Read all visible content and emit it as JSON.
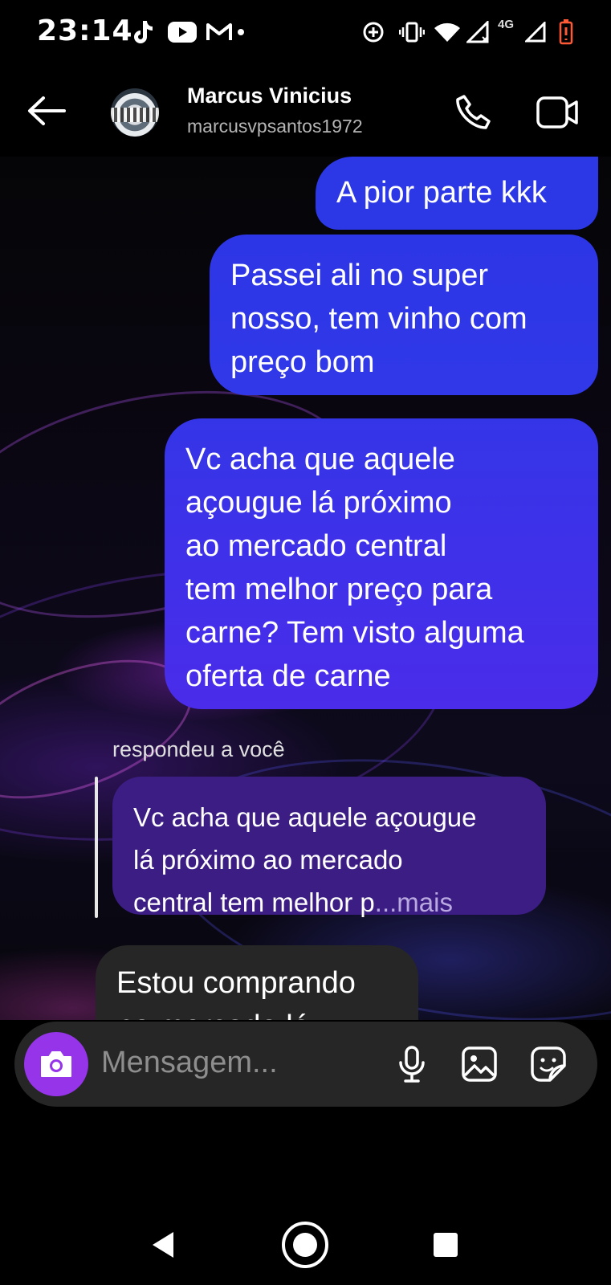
{
  "status_bar": {
    "time": "23:14",
    "network": "4G",
    "icons": [
      "tiktok-icon",
      "youtube-icon",
      "gmail-icon",
      "dot-icon",
      "data-saver-icon",
      "vibrate-icon",
      "wifi-icon",
      "signal-icon",
      "signal-icon",
      "battery-low-icon"
    ]
  },
  "header": {
    "name": "Marcus Vinicius",
    "username": "marcusvpsantos1972",
    "icons": [
      "back-arrow-icon",
      "phone-icon",
      "video-camera-icon"
    ]
  },
  "messages": [
    {
      "from": "me",
      "text": "A pior parte kkk"
    },
    {
      "from": "me",
      "lines": [
        "Passei ali no super",
        "nosso, tem vinho com",
        "preço bom"
      ]
    },
    {
      "from": "me",
      "lines": [
        "Vc acha que aquele",
        "açougue lá próximo",
        "ao mercado central",
        "tem melhor preço para",
        "carne? Tem visto alguma",
        "oferta de carne"
      ]
    },
    {
      "from": "them",
      "lines": [
        "Estou comprando",
        "no mercado lá"
      ]
    }
  ],
  "reply": {
    "label": "respondeu a você",
    "quote_lines": [
      "Vc acha que aquele açougue",
      "lá próximo ao mercado",
      "central tem melhor p"
    ],
    "more": "...mais"
  },
  "composer": {
    "placeholder": "Mensagem...",
    "icons": [
      "camera-icon",
      "microphone-icon",
      "gallery-icon",
      "sticker-icon"
    ]
  },
  "colors": {
    "bubble_me": "#2c37e6",
    "bubble_me_gradient_end": "#4a2cea",
    "quote_bg": "#3b1d83",
    "bubble_them": "#262626",
    "camera_button": "#9534e8"
  }
}
